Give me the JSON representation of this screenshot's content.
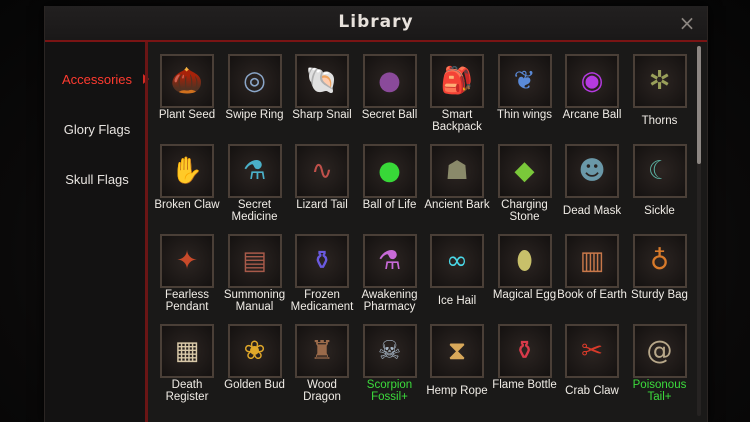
{
  "window": {
    "title": "Library",
    "close_label": "×"
  },
  "sidebar": {
    "tabs": [
      {
        "label": "Accessories",
        "active": true
      },
      {
        "label": "Glory Flags",
        "active": false
      },
      {
        "label": "Skull Flags",
        "active": false
      }
    ]
  },
  "items": [
    {
      "name": "Plant Seed",
      "icon": "seed-icon",
      "glyph": "🌰",
      "color": "#c06a2a",
      "highlight": false
    },
    {
      "name": "Swipe Ring",
      "icon": "ring-icon",
      "glyph": "◎",
      "color": "#8aa6c8",
      "highlight": false
    },
    {
      "name": "Sharp Snail",
      "icon": "snail-icon",
      "glyph": "🐚",
      "color": "#a08a78",
      "highlight": false
    },
    {
      "name": "Secret Ball",
      "icon": "ball-icon",
      "glyph": "●",
      "color": "#8a4a9a",
      "highlight": false
    },
    {
      "name": "Smart Backpack",
      "icon": "backpack-icon",
      "glyph": "🎒",
      "color": "#b07a3a",
      "highlight": false
    },
    {
      "name": "Thin wings",
      "icon": "wings-icon",
      "glyph": "❦",
      "color": "#5a8ad8",
      "highlight": false
    },
    {
      "name": "Arcane Ball",
      "icon": "orb-icon",
      "glyph": "◉",
      "color": "#b43ae0",
      "highlight": false
    },
    {
      "name": "Thorns",
      "icon": "thorns-icon",
      "glyph": "✲",
      "color": "#9aa05a",
      "highlight": false
    },
    {
      "name": "Broken Claw",
      "icon": "claw-icon",
      "glyph": "✋",
      "color": "#4a9a4a",
      "highlight": false
    },
    {
      "name": "Secret Medicine",
      "icon": "medicine-icon",
      "glyph": "⚗",
      "color": "#4ab0c8",
      "highlight": false
    },
    {
      "name": "Lizard Tail",
      "icon": "tail-icon",
      "glyph": "∿",
      "color": "#c0504a",
      "highlight": false
    },
    {
      "name": "Ball of Life",
      "icon": "life-ball-icon",
      "glyph": "●",
      "color": "#38d838",
      "highlight": false
    },
    {
      "name": "Ancient Bark",
      "icon": "bark-icon",
      "glyph": "☗",
      "color": "#8a8a6a",
      "highlight": false
    },
    {
      "name": "Charging Stone",
      "icon": "stone-icon",
      "glyph": "◆",
      "color": "#7ac83a",
      "highlight": false
    },
    {
      "name": "Dead Mask",
      "icon": "mask-icon",
      "glyph": "☻",
      "color": "#6a98a8",
      "highlight": false
    },
    {
      "name": "Sickle",
      "icon": "sickle-icon",
      "glyph": "☾",
      "color": "#5ab0a0",
      "highlight": false
    },
    {
      "name": "Fearless Pendant",
      "icon": "pendant-icon",
      "glyph": "✦",
      "color": "#c84a2a",
      "highlight": false
    },
    {
      "name": "Summoning Manual",
      "icon": "book-icon",
      "glyph": "▤",
      "color": "#a85a4a",
      "highlight": false
    },
    {
      "name": "Frozen Medicament",
      "icon": "vial-icon",
      "glyph": "⚱",
      "color": "#6a5ae0",
      "highlight": false
    },
    {
      "name": "Awakening Pharmacy",
      "icon": "potion-icon",
      "glyph": "⚗",
      "color": "#c86ad8",
      "highlight": false
    },
    {
      "name": "Ice Hail",
      "icon": "chain-icon",
      "glyph": "∞",
      "color": "#4ad8e8",
      "highlight": false
    },
    {
      "name": "Magical Egg",
      "icon": "egg-icon",
      "glyph": "⬮",
      "color": "#c8c06a",
      "highlight": false
    },
    {
      "name": "Book of Earth",
      "icon": "earth-book-icon",
      "glyph": "▥",
      "color": "#c8784a",
      "highlight": false
    },
    {
      "name": "Sturdy Bag",
      "icon": "bag-icon",
      "glyph": "♁",
      "color": "#d87a2a",
      "highlight": false
    },
    {
      "name": "Death Register",
      "icon": "scroll-icon",
      "glyph": "▦",
      "color": "#d8c8a8",
      "highlight": false
    },
    {
      "name": "Golden Bud",
      "icon": "bud-icon",
      "glyph": "❀",
      "color": "#e0a82a",
      "highlight": false
    },
    {
      "name": "Wood Dragon",
      "icon": "totem-icon",
      "glyph": "♜",
      "color": "#9a6a4a",
      "highlight": false
    },
    {
      "name": "Scorpion Fossil+",
      "icon": "scorpion-icon",
      "glyph": "☠",
      "color": "#a8b8c8",
      "highlight": true
    },
    {
      "name": "Hemp Rope",
      "icon": "rope-icon",
      "glyph": "⧗",
      "color": "#d8a85a",
      "highlight": false
    },
    {
      "name": "Flame Bottle",
      "icon": "bottle-icon",
      "glyph": "⚱",
      "color": "#d83a4a",
      "highlight": false
    },
    {
      "name": "Crab Claw",
      "icon": "crab-claw-icon",
      "glyph": "✂",
      "color": "#d83a2a",
      "highlight": false
    },
    {
      "name": "Poisonous Tail+",
      "icon": "poison-tail-icon",
      "glyph": "@",
      "color": "#b8a88a",
      "highlight": true
    }
  ],
  "colors": {
    "accent_red": "#d42a22",
    "highlight_green": "#3cdc3c"
  }
}
